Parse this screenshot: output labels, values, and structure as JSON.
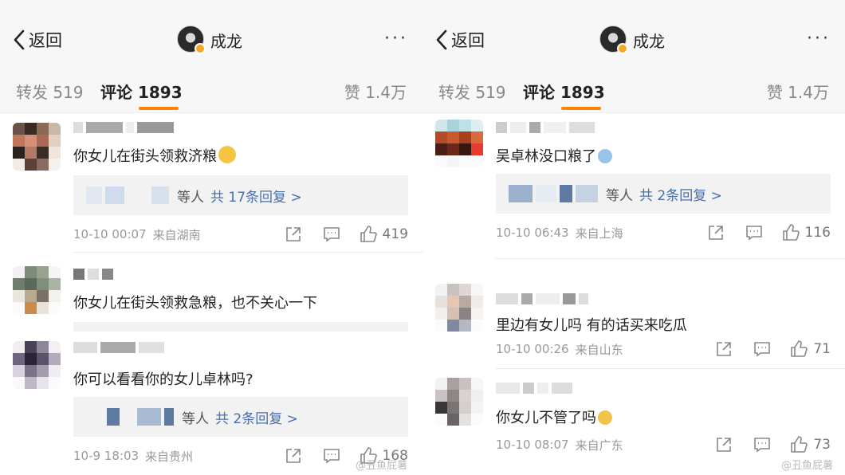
{
  "left": {
    "nav": {
      "back_label": "返回",
      "title": "成龙",
      "more_label": "···"
    },
    "tabs": {
      "repost": "转发 519",
      "comments": "评论 1893",
      "likes": "赞 1.4万"
    },
    "comments": [
      {
        "text": "你女儿在街头领救济粮",
        "reply_wait": "等人",
        "reply_more": "共 17条回复 >",
        "date": "10-10 00:07",
        "location": "来自湖南",
        "likes": "419"
      },
      {
        "text": "你女儿在街头领救急粮，也不关心一下"
      },
      {
        "text": "你可以看看你的女儿卓林吗?",
        "reply_wait": "等人",
        "reply_more": "共 2条回复 >",
        "date": "10-9 18:03",
        "location": "来自贵州",
        "likes": "168"
      }
    ],
    "watermark": "@丑鱼屁薯"
  },
  "right": {
    "nav": {
      "back_label": "返回",
      "title": "成龙",
      "more_label": "···"
    },
    "tabs": {
      "repost": "转发 519",
      "comments": "评论 1893",
      "likes": "赞 1.4万"
    },
    "comments": [
      {
        "text": "吴卓林没口粮了",
        "reply_wait": "等人",
        "reply_more": "共 2条回复 >",
        "date": "10-10 06:43",
        "location": "来自上海",
        "likes": "116"
      },
      {
        "text": "里边有女儿吗 有的话买来吃瓜",
        "date": "10-10 00:26",
        "location": "来自山东",
        "likes": "71"
      },
      {
        "text": "你女儿不管了吗",
        "date": "10-10 08:07",
        "location": "来自广东",
        "likes": "73"
      }
    ],
    "watermark": "@丑鱼屁薯"
  },
  "colors": {
    "accent": "#ff8200",
    "link": "#4a6ea9",
    "nav_bg": "#f7f7f7",
    "reply_bg": "#f2f2f2"
  },
  "icons": [
    "chevron-left-icon",
    "more-icon",
    "share-icon",
    "comment-icon",
    "thumbs-up-icon",
    "emoji-icon",
    "verified-badge-icon"
  ]
}
